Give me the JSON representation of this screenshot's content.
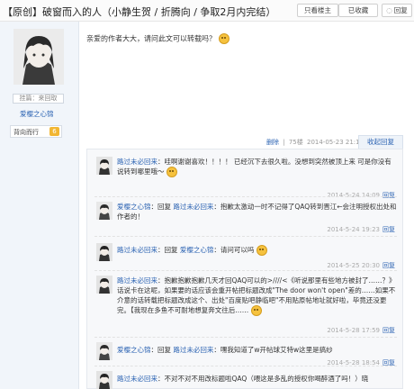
{
  "thread": {
    "title": "【原创】破窗而入的人（小静生贺 / 折腾向 / 争取2月内完结）",
    "buttons": [
      {
        "label": "只看楼主"
      },
      {
        "label": "已收藏"
      },
      {
        "label": "回复"
      }
    ]
  },
  "author": {
    "score_tag": "挂篇：来回取",
    "name": "爱樱之心锦",
    "badge_label": "背向而行",
    "badge_level": "6"
  },
  "post": {
    "text": "亲爱的作者大大，请问此文可以转载吗？",
    "delete_label": "删除",
    "floor": "75楼",
    "time": "2014-05-23 21:12",
    "collapse_label": "收起回复"
  },
  "replies": [
    {
      "user": "路过未必回来",
      "text": "哇啊谢谢喜欢！！！！ 已经沉下去很久啦。没想到突然被顶上来 可是你没有说转到哪里哦～",
      "time": "2014-5-24 14:09",
      "reply_label": "回复"
    },
    {
      "user": "爱樱之心锦",
      "prefix": "回复 ",
      "at": "路过未必回来",
      "text": "：抱歉太激动一时不记得了QAQ转到晋江←会注明授权出处和作者的！",
      "time": "2014-5-24 19:23",
      "reply_label": "回复"
    },
    {
      "user": "路过未必回来",
      "prefix": "回复 ",
      "at": "爱樱之心锦",
      "text": "：请问可以吗",
      "time": "2014-5-25 20:30",
      "reply_label": "回复"
    },
    {
      "user": "路过未必回来",
      "text": "抱歉抱歉抱歉几天才回QAQ可以的>////<《听说那里有些地方被封了……？》话说卡在这呢，如果要的话应该会重开帖把标题改成\"The door won't open\"差的……如果不介意的话转载把标题改成这个、出处\"百度贴吧静临吧\"不用贴原帖地址就好啦，毕竟还没更完。【我现在多鱼不可耐地想复奔文往后……",
      "time": "2014-5-28 17:59",
      "reply_label": "回复"
    },
    {
      "user": "爱樱之心锦",
      "prefix": "回复 ",
      "at": "路过未必回来",
      "text": "：嘿我知道了w开帖球艾特w这里是搞纱",
      "time": "2014-5-28 18:54",
      "reply_label": "回复"
    },
    {
      "user": "路过未必回来",
      "text": "不对不对不用改标题啦QAQ（喂这是多乱的授权你喝醉酒了吗！）晓",
      "time": "",
      "reply_label": ""
    }
  ]
}
